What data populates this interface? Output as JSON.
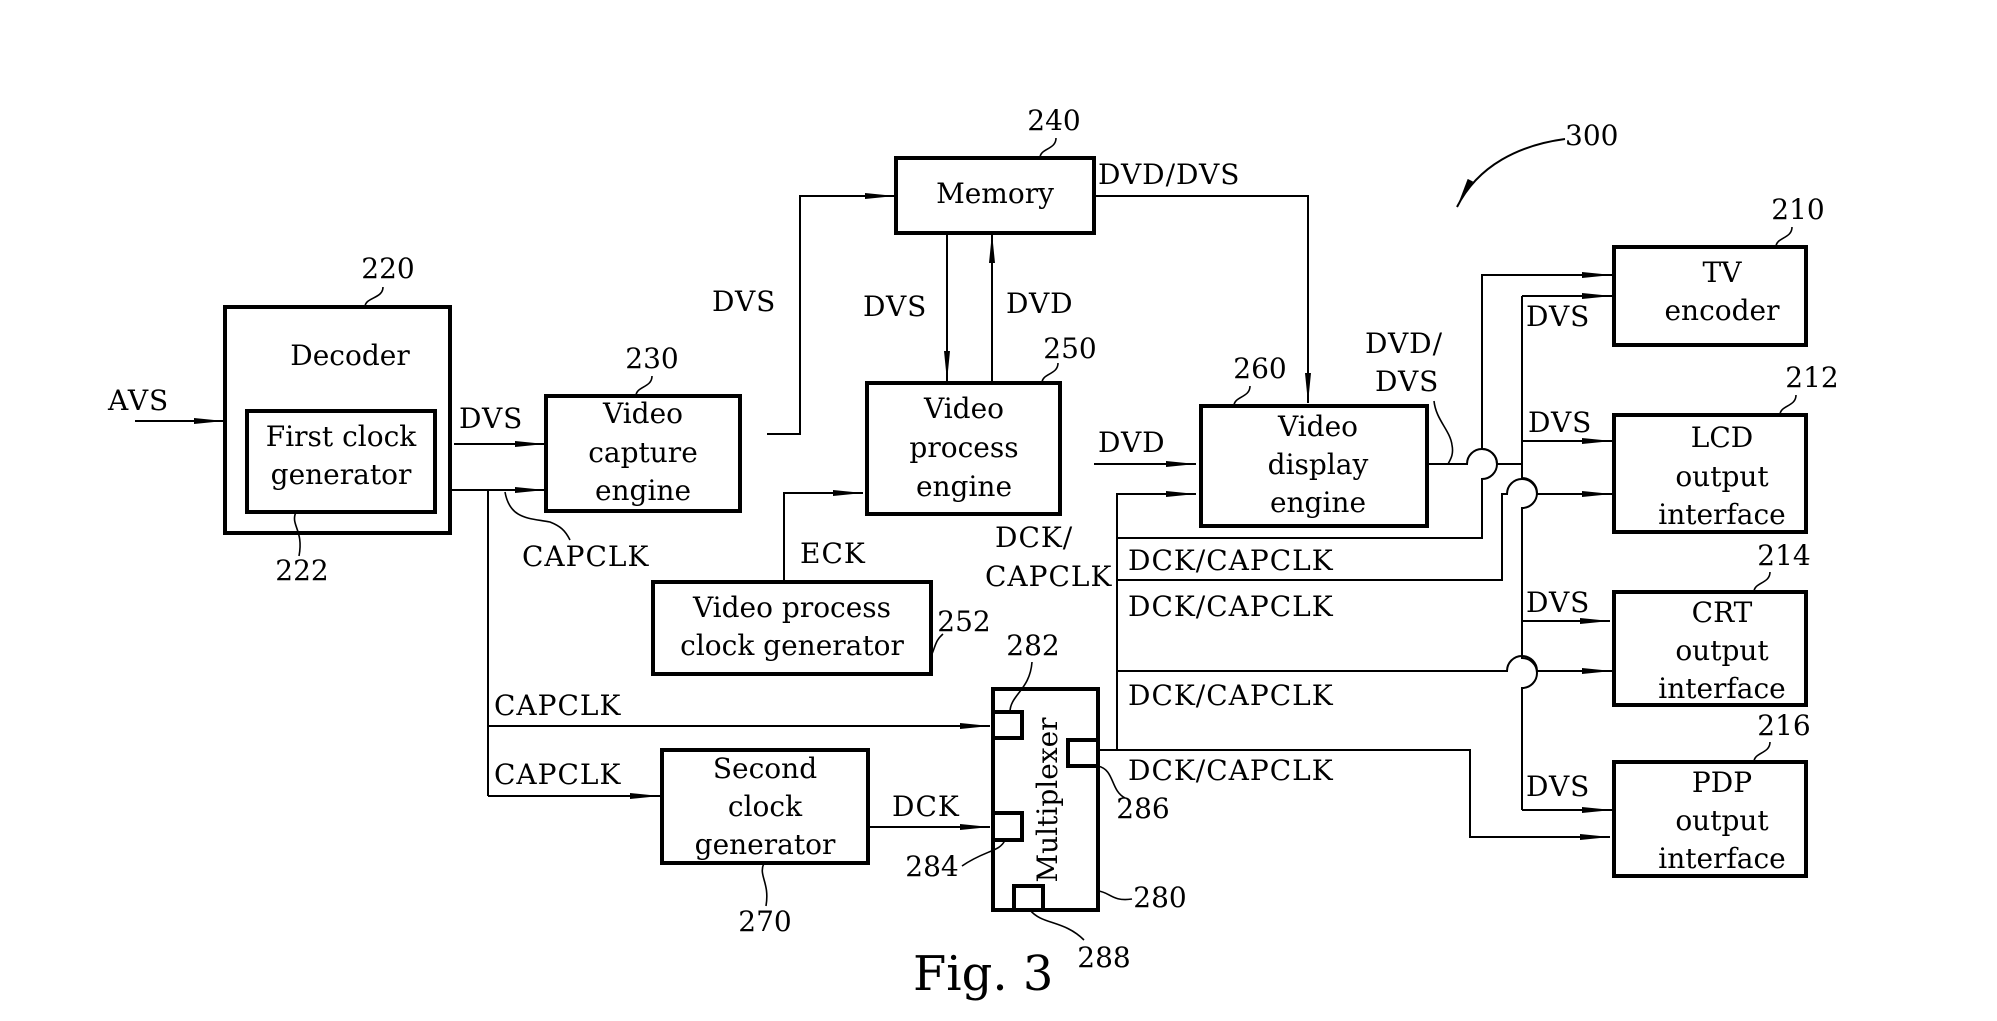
{
  "figure": {
    "caption": "Fig. 3",
    "system_ref": "300"
  },
  "blocks": {
    "decoder": {
      "ref": "220",
      "label": [
        "Decoder"
      ]
    },
    "first_clock": {
      "ref": "222",
      "label": [
        "First clock",
        "generator"
      ]
    },
    "video_capture": {
      "ref": "230",
      "label": [
        "Video",
        "capture",
        "engine"
      ]
    },
    "memory": {
      "ref": "240",
      "label": [
        "Memory"
      ]
    },
    "video_process": {
      "ref": "250",
      "label": [
        "Video",
        "process",
        "engine"
      ]
    },
    "vp_clock": {
      "ref": "252",
      "label": [
        "Video process",
        "clock generator"
      ]
    },
    "video_display": {
      "ref": "260",
      "label": [
        "Video",
        "display",
        "engine"
      ]
    },
    "second_clock": {
      "ref": "270",
      "label": [
        "Second",
        "clock",
        "generator"
      ]
    },
    "multiplexer": {
      "ref": "280",
      "label": [
        "Multiplexer"
      ],
      "ports": [
        "282",
        "284",
        "286",
        "288"
      ]
    },
    "tv_encoder": {
      "ref": "210",
      "label": [
        "TV",
        "encoder"
      ]
    },
    "lcd": {
      "ref": "212",
      "label": [
        "LCD",
        "output",
        "interface"
      ]
    },
    "crt": {
      "ref": "214",
      "label": [
        "CRT",
        "output",
        "interface"
      ]
    },
    "pdp": {
      "ref": "216",
      "label": [
        "PDP",
        "output",
        "interface"
      ]
    }
  },
  "signals": {
    "avs": "AVS",
    "dvs_decoder_capture": "DVS",
    "capclk_decoder": "CAPCLK",
    "dvs_capture_memory": "DVS",
    "dvs_memory_process": "DVS",
    "dvd_process_memory": "DVD",
    "dvd_dvs_memory_display": "DVD/DVS",
    "dvd_process_display": "DVD",
    "eck": "ECK",
    "dck_capclk_display": [
      "DCK/",
      "CAPCLK"
    ],
    "dvd_dvs_out": [
      "DVD/",
      "DVS"
    ],
    "dvs_tv": "DVS",
    "dvs_lcd": "DVS",
    "dvs_crt": "DVS",
    "dvs_pdp": "DVS",
    "dck_capclk_tv": "DCK/CAPCLK",
    "dck_capclk_lcd": "DCK/CAPCLK",
    "dck_capclk_crt": "DCK/CAPCLK",
    "dck_capclk_pdp": "DCK/CAPCLK",
    "capclk_mux": "CAPCLK",
    "capclk_second": "CAPCLK",
    "dck": "DCK"
  }
}
